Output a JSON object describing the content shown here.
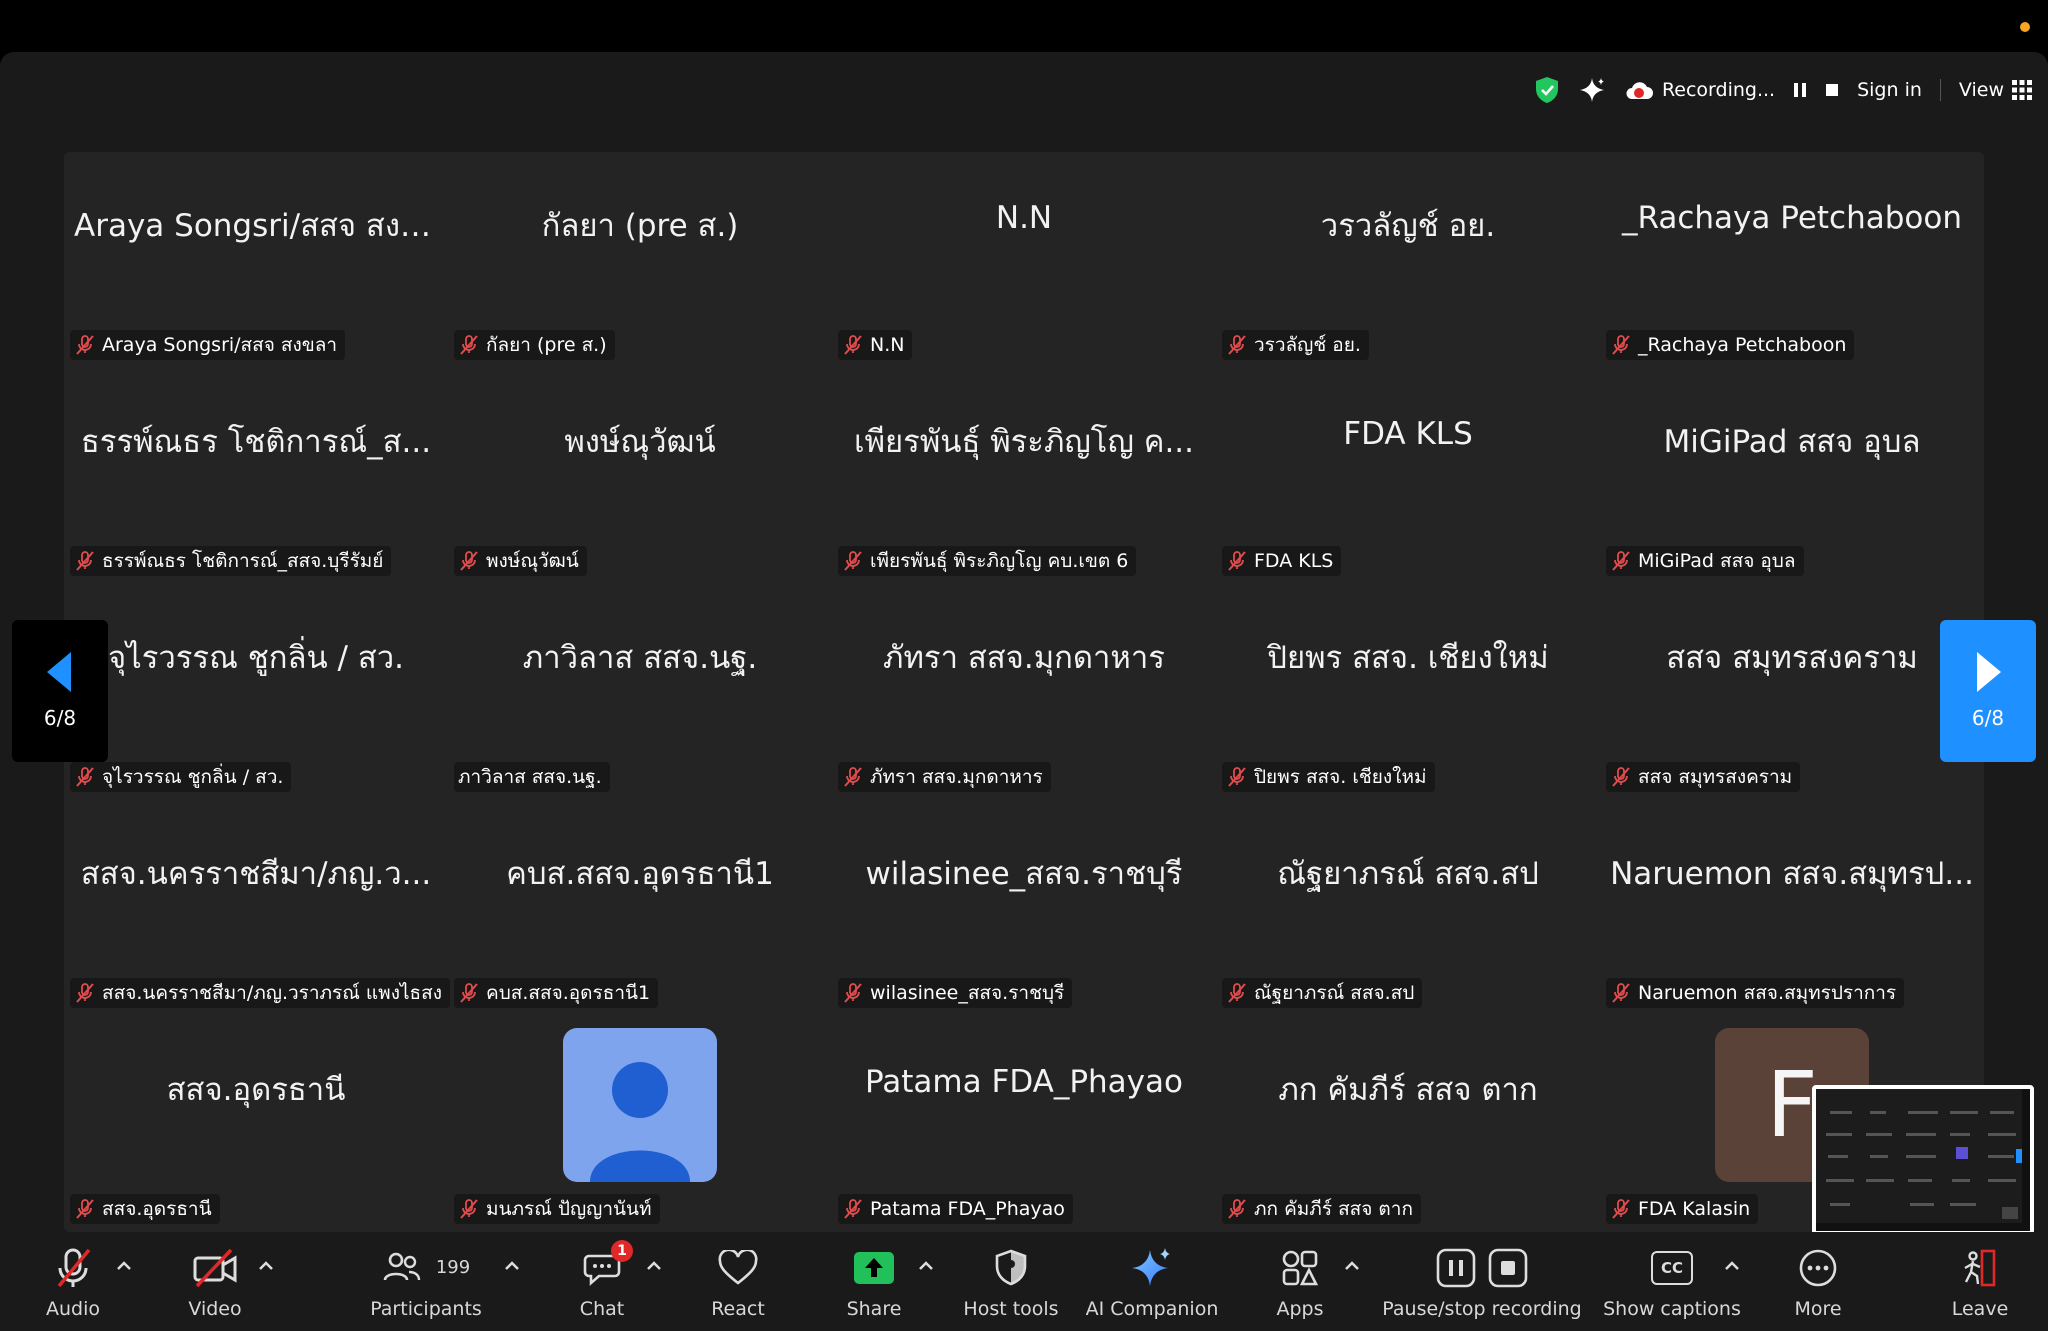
{
  "colors": {
    "accent_blue": "#1e90ff",
    "share_green": "#21c05a",
    "record_red": "#e02828",
    "shield_green": "#22c55e",
    "orange_dot": "#f5a623",
    "chat_badge": "#e02828"
  },
  "status_bar": {
    "recording_label": "Recording...",
    "sign_in_label": "Sign in",
    "view_label": "View"
  },
  "gallery": {
    "page_indicator": "6/8",
    "tiles": [
      {
        "display": "Araya Songsri/สสจ สงข...",
        "label": "Araya Songsri/สสจ สงขลา"
      },
      {
        "display": "กัลยา (pre ส.)",
        "label": "กัลยา (pre ส.)"
      },
      {
        "display": "N.N",
        "label": "N.N"
      },
      {
        "display": "วรวลัญช์ อย.",
        "label": "วรวลัญช์ อย."
      },
      {
        "display": "_Rachaya Petchaboon",
        "label": "_Rachaya Petchaboon"
      },
      {
        "display": "ธรรพ์ณธร โชติการณ์_ส...",
        "label": "ธรรพ์ณธร โชติการณ์_สสจ.บุรีรัมย์"
      },
      {
        "display": "พงษ์ณุวัฒน์",
        "label": "พงษ์ณุวัฒน์"
      },
      {
        "display": "เพียรพันธุ์ พิระภิญโญ ค...",
        "label": "เพียรพันธุ์ พิระภิญโญ คบ.เขต 6"
      },
      {
        "display": "FDA KLS",
        "label": "FDA KLS"
      },
      {
        "display": "MiGiPad สสจ อุบล",
        "label": "MiGiPad สสจ อุบล"
      },
      {
        "display": "จุไรวรรณ ชูกลิ่น / สว.",
        "label": "จุไรวรรณ ชูกลิ่น / สว."
      },
      {
        "display": "ภาวิลาส สสจ.นฐ.",
        "label": "ภาวิลาส สสจ.นฐ."
      },
      {
        "display": "ภัทรา สสจ.มุกดาหาร",
        "label": "ภัทรา สสจ.มุกดาหาร"
      },
      {
        "display": "ปิยพร สสจ. เชียงใหม่",
        "label": "ปิยพร สสจ. เชียงใหม่"
      },
      {
        "display": "สสจ สมุทรสงคราม",
        "label": "สสจ สมุทรสงคราม"
      },
      {
        "display": "สสจ.นครราชสีมา/ภญ.ว...",
        "label": "สสจ.นครราชสีมา/ภญ.วราภรณ์ แพงไธสง"
      },
      {
        "display": "คบส.สสจ.อุดรธานี1",
        "label": "คบส.สสจ.อุดรธานี1"
      },
      {
        "display": "wilasinee_สสจ.ราชบุรี",
        "label": "wilasinee_สสจ.ราชบุรี"
      },
      {
        "display": "ณัฐยาภรณ์ สสจ.สป",
        "label": "ณัฐยาภรณ์ สสจ.สป"
      },
      {
        "display": "Naruemon สสจ.สมุทรป...",
        "label": "Naruemon สสจ.สมุทรปราการ"
      },
      {
        "display": "สสจ.อุดรธานี",
        "label": "สสจ.อุดรธานี"
      },
      {
        "display": "",
        "label": "มนภรณ์ ปัญญานันท์"
      },
      {
        "display": "Patama FDA_Phayao",
        "label": "Patama FDA_Phayao"
      },
      {
        "display": "ภก คัมภีร์ สสจ ตาก",
        "label": "ภก คัมภีร์ สสจ ตาก"
      },
      {
        "display": "",
        "label": "FDA Kalasin"
      }
    ],
    "avatar_letter": "F"
  },
  "toolbar": {
    "audio": "Audio",
    "video": "Video",
    "participants": "Participants",
    "participants_count": "199",
    "chat": "Chat",
    "chat_badge": "1",
    "react": "React",
    "share": "Share",
    "host_tools": "Host tools",
    "ai_companion": "AI Companion",
    "apps": "Apps",
    "pause_stop_recording": "Pause/stop recording",
    "show_captions": "Show captions",
    "cc": "CC",
    "more": "More",
    "leave": "Leave"
  }
}
